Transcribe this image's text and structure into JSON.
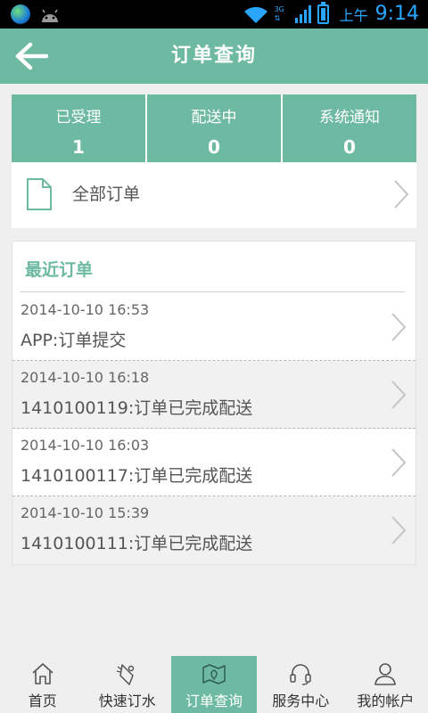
{
  "status_bar": {
    "network": "3G",
    "am_pm": "上午",
    "time": "9:14"
  },
  "header": {
    "title": "订单查询",
    "back_icon": "back-arrow-icon"
  },
  "stats": [
    {
      "label": "已受理",
      "value": "1"
    },
    {
      "label": "配送中",
      "value": "0"
    },
    {
      "label": "系统通知",
      "value": "0"
    }
  ],
  "all_orders": {
    "label": "全部订单",
    "icon": "document-icon"
  },
  "recent": {
    "title": "最近订单",
    "items": [
      {
        "time": "2014-10-10 16:53",
        "text": "APP:订单提交"
      },
      {
        "time": "2014-10-10 16:18",
        "text": "1410100119:订单已完成配送"
      },
      {
        "time": "2014-10-10 16:03",
        "text": "1410100117:订单已完成配送"
      },
      {
        "time": "2014-10-10 15:39",
        "text": "1410100111:订单已完成配送"
      }
    ]
  },
  "bottom_nav": [
    {
      "label": "首页",
      "icon": "home-icon",
      "active": false
    },
    {
      "label": "快速订水",
      "icon": "water-order-icon",
      "active": false
    },
    {
      "label": "订单查询",
      "icon": "map-icon",
      "active": true
    },
    {
      "label": "服务中心",
      "icon": "headset-icon",
      "active": false
    },
    {
      "label": "我的帐户",
      "icon": "user-icon",
      "active": false
    }
  ],
  "colors": {
    "accent": "#6db9a2",
    "status_blue": "#2aa6ff",
    "background": "#efeff0"
  }
}
